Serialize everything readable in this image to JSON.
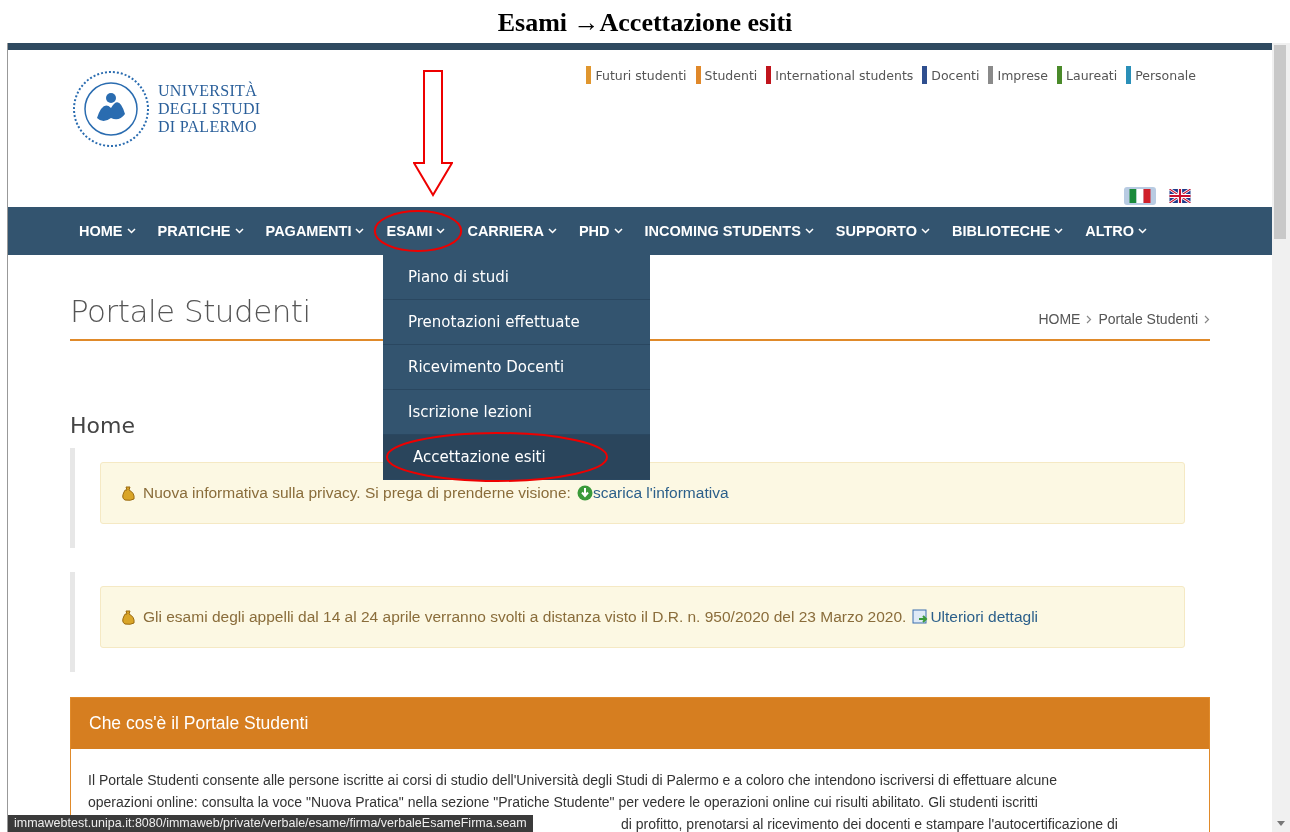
{
  "heading": "Esami →Accettazione esiti",
  "logo": {
    "lines": [
      "UNIVERSITÀ",
      "DEGLI STUDI",
      "DI PALERMO"
    ]
  },
  "audience_links": [
    {
      "label": "Futuri studenti",
      "color": "#e0962e"
    },
    {
      "label": "Studenti",
      "color": "#e0882a"
    },
    {
      "label": "International students",
      "color": "#c0141c"
    },
    {
      "label": "Docenti",
      "color": "#2f4f8f"
    },
    {
      "label": "Imprese",
      "color": "#8a8a8a"
    },
    {
      "label": "Laureati",
      "color": "#4a8a2a"
    },
    {
      "label": "Personale",
      "color": "#2a8fb8"
    }
  ],
  "languages": [
    {
      "kind": "italian",
      "selected": true
    },
    {
      "kind": "english",
      "selected": false
    }
  ],
  "nav": [
    {
      "label": "HOME",
      "circled": false
    },
    {
      "label": "PRATICHE",
      "circled": false
    },
    {
      "label": "PAGAMENTI",
      "circled": false
    },
    {
      "label": "ESAMI",
      "circled": true
    },
    {
      "label": "CARRIERA",
      "circled": false
    },
    {
      "label": "PHD",
      "circled": false
    },
    {
      "label": "INCOMING STUDENTS",
      "circled": false
    },
    {
      "label": "SUPPORTO",
      "circled": false
    },
    {
      "label": "BIBLIOTECHE",
      "circled": false
    },
    {
      "label": "ALTRO",
      "circled": false
    }
  ],
  "dropdown": [
    {
      "label": "Piano di studi",
      "selected": false,
      "circled": false
    },
    {
      "label": "Prenotazioni effettuate",
      "selected": false,
      "circled": false
    },
    {
      "label": "Ricevimento Docenti",
      "selected": false,
      "circled": false
    },
    {
      "label": "Iscrizione lezioni",
      "selected": false,
      "circled": false
    },
    {
      "label": "Accettazione esiti",
      "selected": true,
      "circled": true
    }
  ],
  "page_title": "Portale Studenti",
  "breadcrumb": [
    "HOME",
    "Portale Studenti"
  ],
  "section_title": "Home",
  "alerts": [
    {
      "text": "Nuova informativa sulla privacy. Si prega di prenderne visione:",
      "link": "scarica l'informativa",
      "kind": "download"
    },
    {
      "text": "Gli esami degli appelli dal 14 al 24 aprile verranno svolti a distanza visto il D.R. n. 950/2020 del 23 Marzo 2020.",
      "link": "Ulteriori dettagli",
      "kind": "document"
    }
  ],
  "panel": {
    "title": "Che cos'è il Portale Studenti",
    "lines": [
      "Il Portale Studenti consente alle persone iscritte ai corsi di studio dell'Università degli Studi di Palermo e a coloro che intendono iscriversi di effettuare alcune",
      "operazioni online: consulta la voce \"Nuova Pratica\" nella sezione \"Pratiche Studente\" per vedere le operazioni online cui risulti abilitato. Gli studenti iscritti",
      "di profitto, prenotarsi al ricevimento dei docenti e stampare l'autocertificazione di"
    ]
  },
  "status_url": "immawebtest.unipa.it:8080/immaweb/private/verbale/esame/firma/verbaleEsameFirma.seam"
}
